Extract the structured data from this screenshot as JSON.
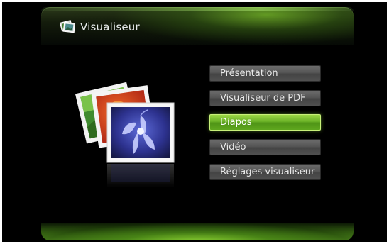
{
  "header": {
    "title": "Visualiseur",
    "icon": "photos-icon"
  },
  "menu": {
    "items": [
      {
        "label": "Présentation",
        "selected": false
      },
      {
        "label": "Visualiseur de PDF",
        "selected": false
      },
      {
        "label": "Diapos",
        "selected": true
      },
      {
        "label": "Vidéo",
        "selected": false
      },
      {
        "label": "Réglages visualiseur",
        "selected": false
      }
    ]
  },
  "colors": {
    "accent_green": "#6ab126",
    "button_gray": "#555555",
    "background": "#000000"
  },
  "illustration": "photo-stack-icon"
}
